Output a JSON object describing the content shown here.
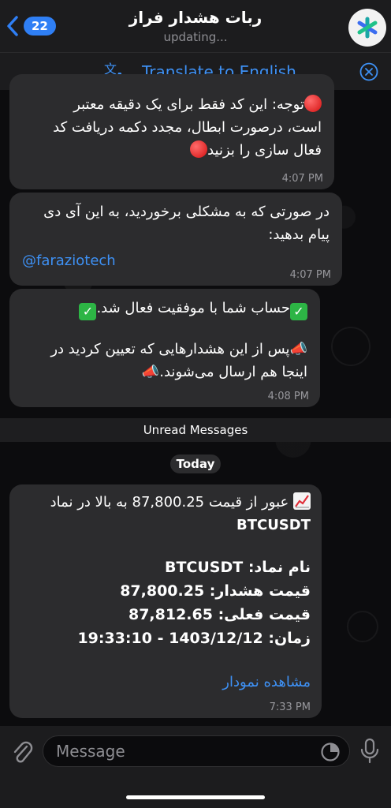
{
  "header": {
    "back_count": "22",
    "title": "ربات هشدار فراز",
    "status": "updating..."
  },
  "translate_bar": {
    "label": "Translate to English"
  },
  "messages": [
    {
      "lines": [
        "توجه: این کد فقط برای یک دقیقه معتبر",
        "است، درصورت ابطال، مجدد دکمه دریافت کد",
        "فعال سازی را بزنید"
      ],
      "time": "4:07 PM"
    },
    {
      "lines": [
        "در صورتی که به مشکلی برخوردید، به این آی دی",
        "پیام بدهید:"
      ],
      "link": "@faraziotech",
      "time": "4:07 PM"
    },
    {
      "lines": [
        "حساب شما با موفقیت فعال شد.",
        "پس از این هشدارهایی که تعیین کردید در",
        "اینجا هم ارسال می‌شوند."
      ],
      "time": "4:08 PM"
    },
    {
      "lines": [
        "عبور از قیمت 87,800.25 به بالا در نماد",
        "BTCUSDT",
        "نام نماد: BTCUSDT",
        "قیمت هشدار: 87,800.25",
        "قیمت فعلی: 87,812.65",
        "زمان: 1403/12/12 - 19:33:10"
      ],
      "link": "مشاهده نمودار",
      "time": "7:33 PM"
    }
  ],
  "separators": {
    "unread": "Unread Messages",
    "date": "Today"
  },
  "input": {
    "placeholder": "Message"
  },
  "colors": {
    "accent": "#3e91f5",
    "bubble": "#2c2c2e",
    "badge": "#2f7ff5"
  }
}
